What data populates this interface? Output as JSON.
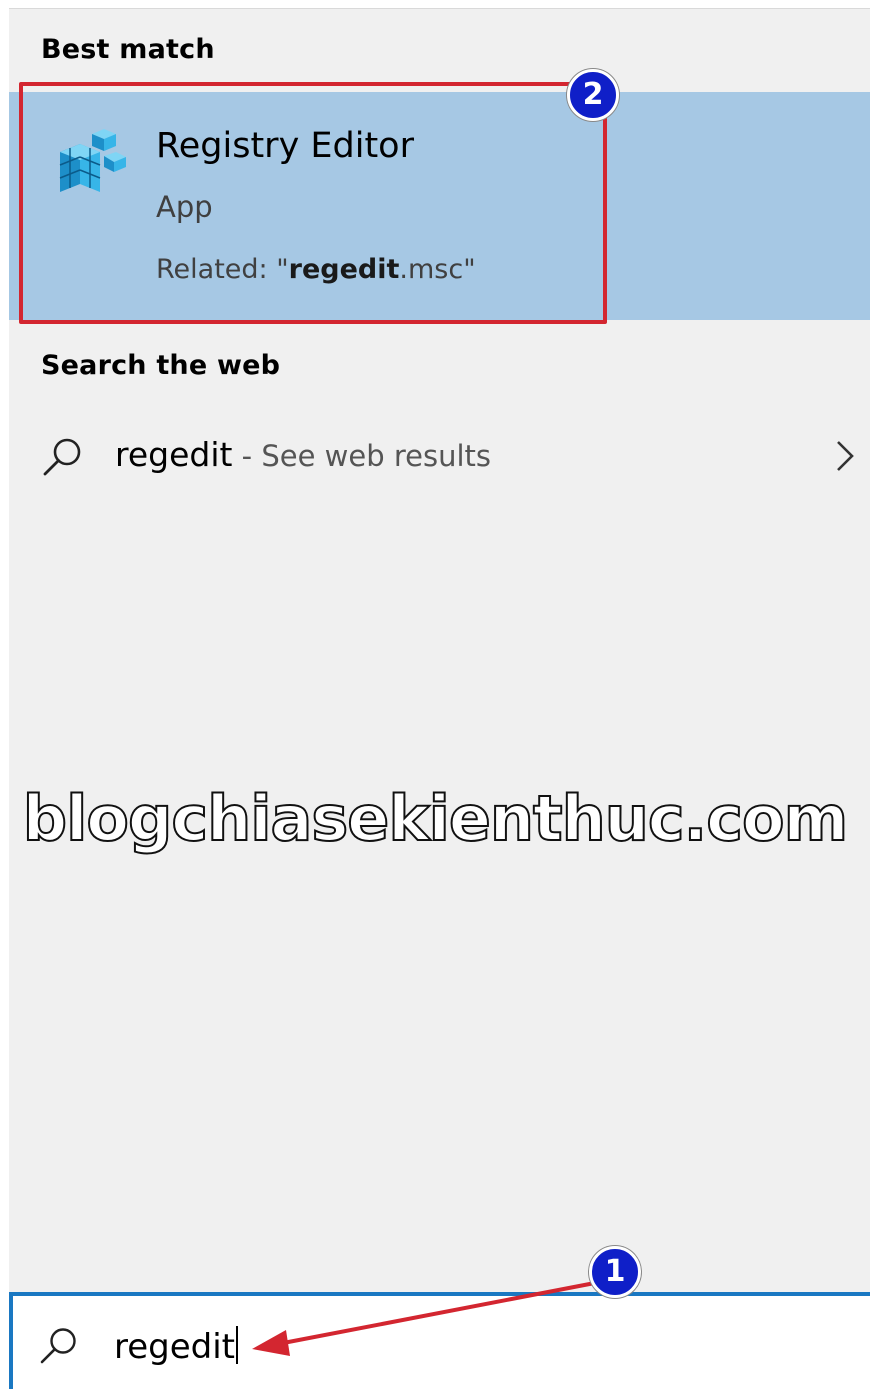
{
  "best_match": {
    "heading": "Best match",
    "app_name": "Registry Editor",
    "app_type": "App",
    "related_prefix": "Related: \"",
    "related_bold": "regedit",
    "related_suffix": ".msc\"",
    "icon": "registry-editor-icon"
  },
  "web_search": {
    "heading": "Search the web",
    "query": "regedit",
    "suffix": " - See web results",
    "icon": "search-icon",
    "chevron_icon": "chevron-right-icon"
  },
  "watermark": "blogchiasekienthuc.com",
  "search_box": {
    "value": "regedit",
    "icon": "search-icon"
  },
  "annotations": {
    "step1": "1",
    "step2": "2",
    "highlight_color": "#d32630",
    "badge_color": "#0f1fc8"
  },
  "colors": {
    "panel_bg": "#f0f0f0",
    "selected_bg": "#a6c8e4",
    "accent": "#1a78c2"
  }
}
